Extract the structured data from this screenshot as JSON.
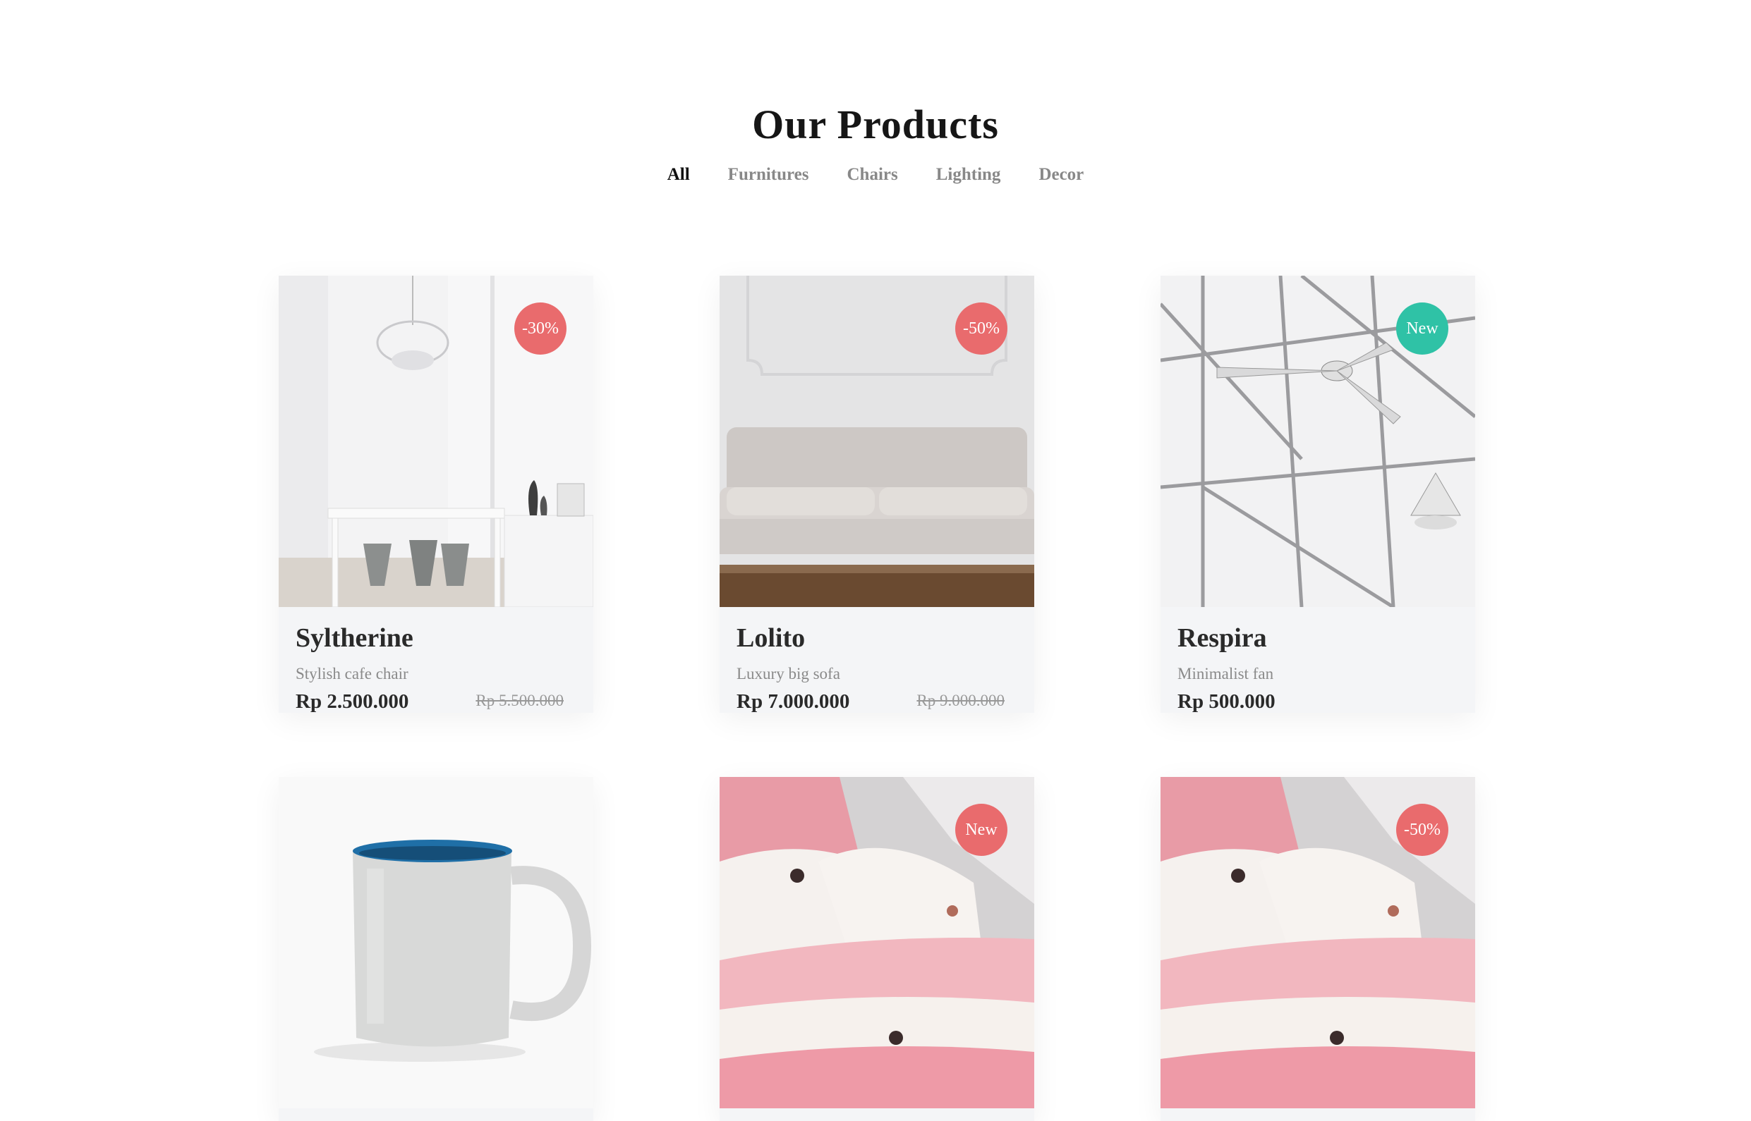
{
  "header": {
    "title": "Our Products"
  },
  "filters": [
    {
      "label": "All",
      "active": true
    },
    {
      "label": "Furnitures",
      "active": false
    },
    {
      "label": "Chairs",
      "active": false
    },
    {
      "label": "Lighting",
      "active": false
    },
    {
      "label": "Decor",
      "active": false
    }
  ],
  "colors": {
    "discount_badge": "#e96b6d",
    "new_badge": "#2fc2a6",
    "card_bg": "#f4f5f7"
  },
  "products": [
    {
      "name": "Syltherine",
      "description": "Stylish cafe chair",
      "price": "Rp 2.500.000",
      "old_price": "Rp 5.500.000",
      "badge": "-30%",
      "badge_type": "discount",
      "image": "dining-room-chandelier-image"
    },
    {
      "name": "Lolito",
      "description": "Luxury big sofa",
      "price": "Rp 7.000.000",
      "old_price": "Rp 9.000.000",
      "badge": "-50%",
      "badge_type": "discount",
      "image": "white-sofa-image"
    },
    {
      "name": "Respira",
      "description": "Minimalist fan",
      "price": "Rp 500.000",
      "old_price": "",
      "badge": "New",
      "badge_type": "new",
      "image": "ceiling-fan-image"
    },
    {
      "name": "",
      "description": "",
      "price": "",
      "old_price": "",
      "badge": "",
      "badge_type": "none",
      "image": "mug-image"
    },
    {
      "name": "",
      "description": "",
      "price": "",
      "old_price": "",
      "badge": "New",
      "badge_type": "new-red",
      "image": "pink-bedding-image"
    },
    {
      "name": "",
      "description": "",
      "price": "",
      "old_price": "",
      "badge": "-50%",
      "badge_type": "discount",
      "image": "pink-bedding-image"
    }
  ]
}
